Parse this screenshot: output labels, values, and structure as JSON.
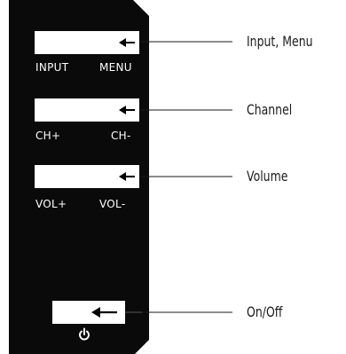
{
  "panel": {
    "buttons": [
      {
        "left_label": "INPUT",
        "right_label": "MENU",
        "callout": "Input, Menu"
      },
      {
        "left_label": "CH+",
        "right_label": "CH-",
        "callout": "Channel"
      },
      {
        "left_label": "VOL+",
        "right_label": "VOL-",
        "callout": "Volume"
      },
      {
        "left_label": "",
        "right_label": "",
        "callout": "On/Off"
      }
    ],
    "power_icon": "power-icon"
  },
  "colors": {
    "panel": "#0a0a0a",
    "button": "#ffffff",
    "leader": "#1a1a1a"
  }
}
